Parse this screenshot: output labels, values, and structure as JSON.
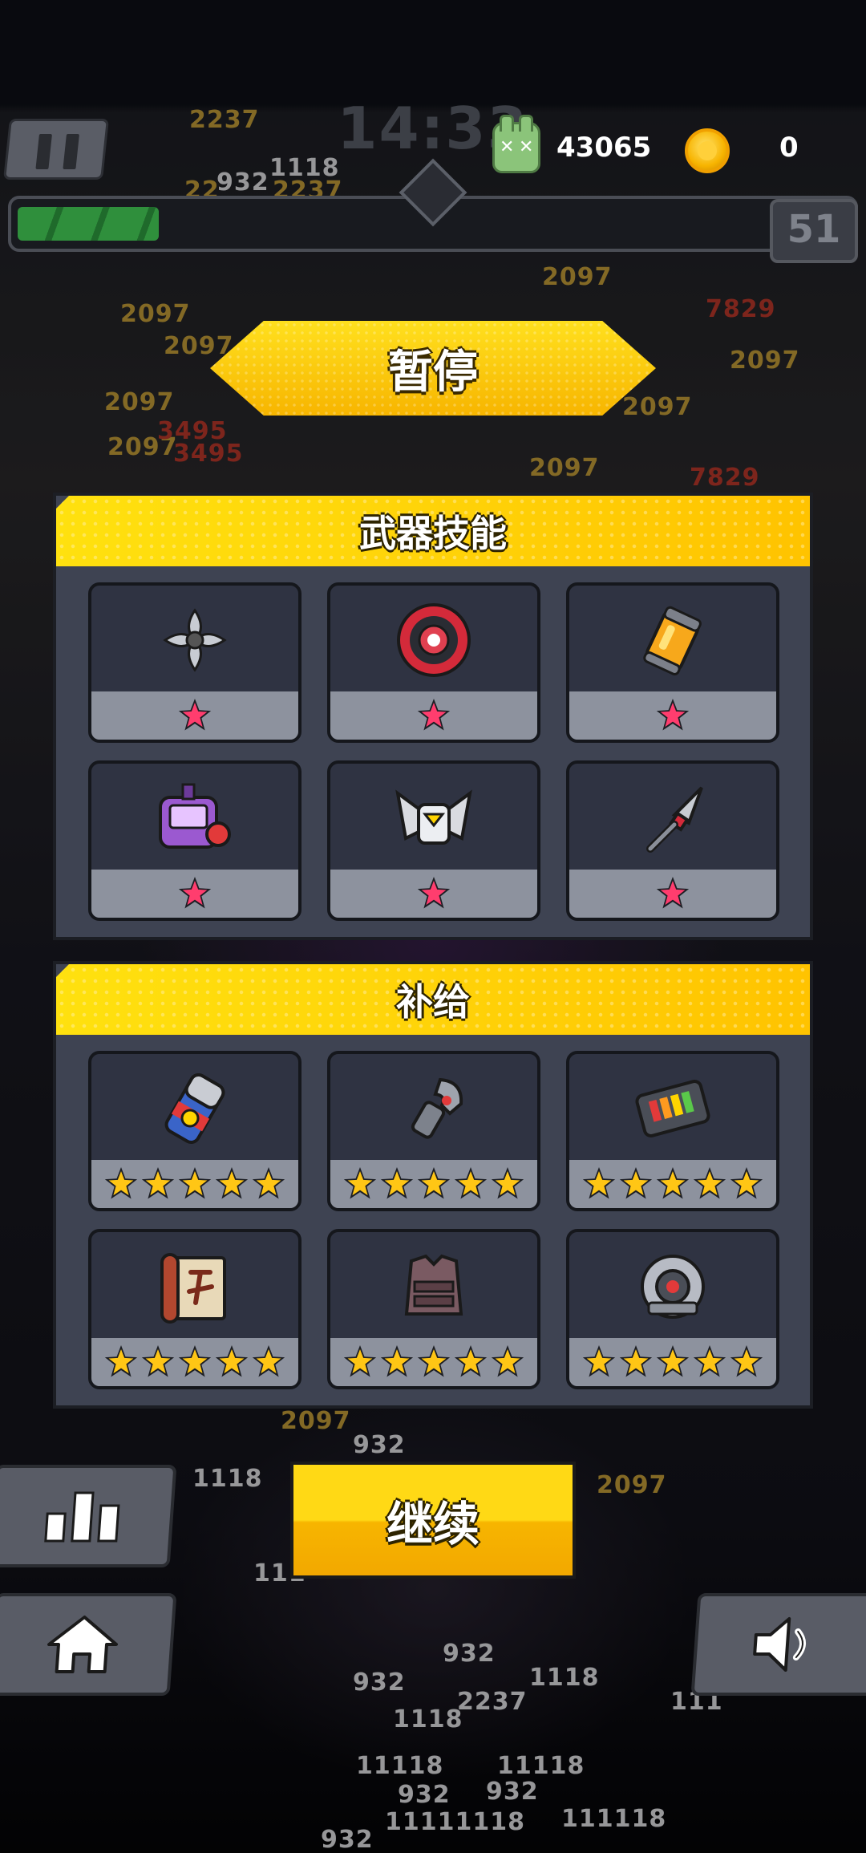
{
  "hud": {
    "timer": "14:33",
    "kill_icon": "zombie-head-icon",
    "kill_count": "43065",
    "coin_icon": "gold-coin-icon",
    "coin_count": "0",
    "level": "51",
    "xp_progress": 0.17
  },
  "pause_title": "暂停",
  "weapon_section": {
    "title": "武器技能",
    "items": [
      {
        "icon": "shuriken-icon",
        "stars": 1
      },
      {
        "icon": "red-eye-disc-icon",
        "stars": 1
      },
      {
        "icon": "molotov-canister-icon",
        "stars": 1
      },
      {
        "icon": "purple-gadget-icon",
        "stars": 1
      },
      {
        "icon": "drone-head-icon",
        "stars": 1
      },
      {
        "icon": "kunai-icon",
        "stars": 1
      }
    ]
  },
  "supply_section": {
    "title": "补给",
    "items": [
      {
        "icon": "energy-drink-icon",
        "stars": 5
      },
      {
        "icon": "robot-arm-icon",
        "stars": 5
      },
      {
        "icon": "battery-pack-icon",
        "stars": 5
      },
      {
        "icon": "scroll-icon",
        "stars": 5
      },
      {
        "icon": "armor-vest-icon",
        "stars": 5
      },
      {
        "icon": "ring-core-icon",
        "stars": 5
      }
    ]
  },
  "continue_label": "继续",
  "buttons": {
    "stats_icon": "bar-chart-icon",
    "home_icon": "home-icon",
    "sound_icon": "speaker-icon"
  },
  "colors": {
    "accent_yellow": "#ffd60a",
    "panel_bg": "#3e4352",
    "star_pink": "#ff3d6e",
    "star_gold": "#ffc615"
  }
}
